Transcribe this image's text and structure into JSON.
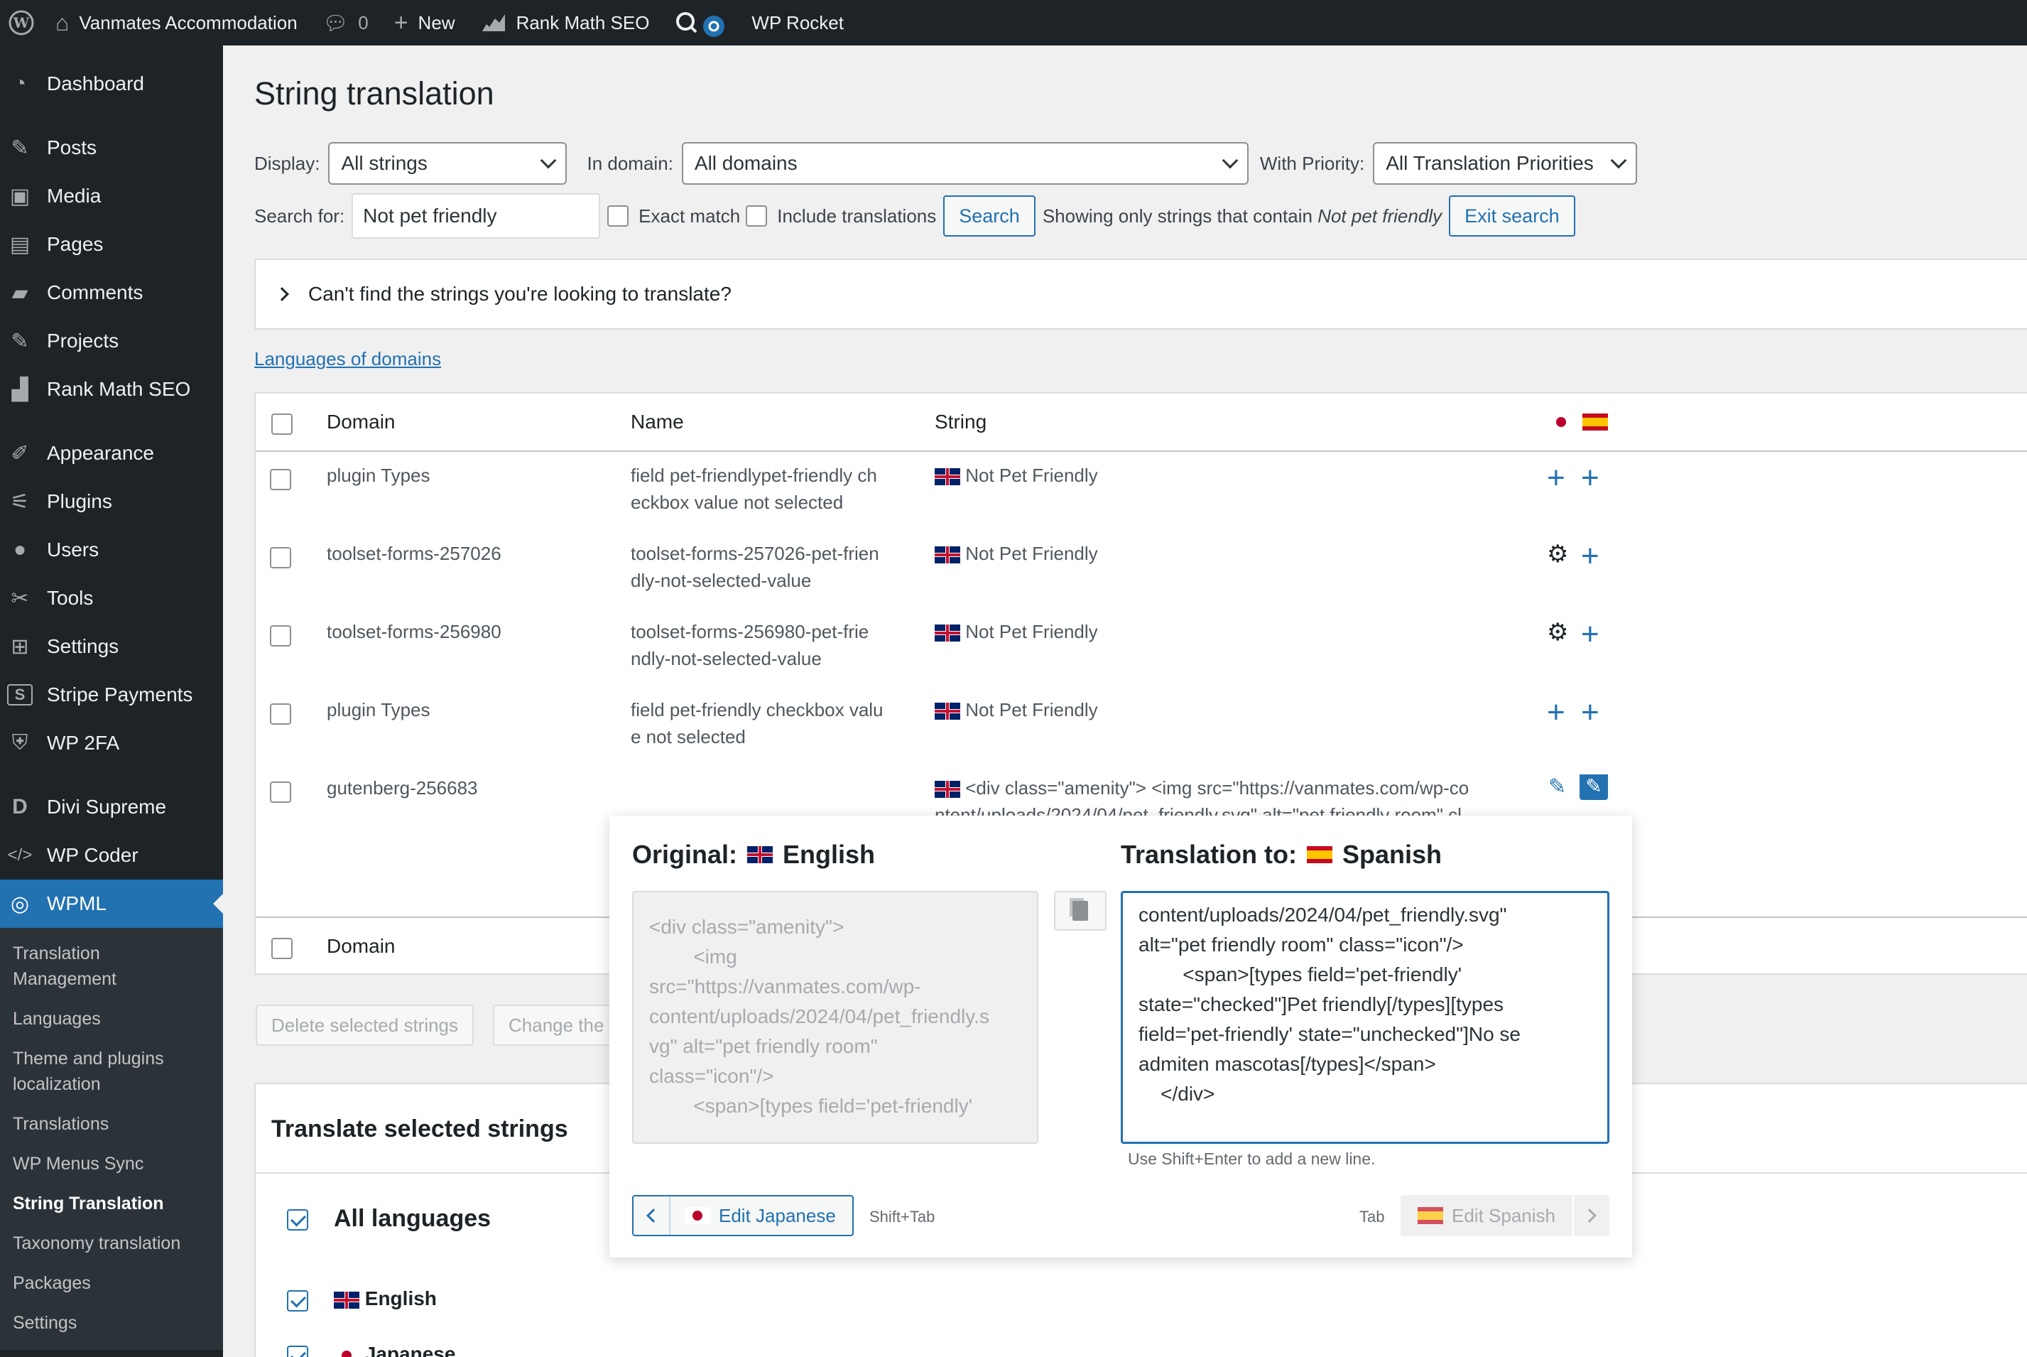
{
  "adminbar": {
    "site_name": "Vanmates Accommodation",
    "comments_count": "0",
    "new_label": "New",
    "rankmath_label": "Rank Math SEO",
    "wprocket_label": "WP Rocket"
  },
  "sidebar": {
    "items": [
      {
        "label": "Dashboard"
      },
      {
        "label": "Posts"
      },
      {
        "label": "Media"
      },
      {
        "label": "Pages"
      },
      {
        "label": "Comments"
      },
      {
        "label": "Projects"
      },
      {
        "label": "Rank Math SEO"
      },
      {
        "label": "Appearance"
      },
      {
        "label": "Plugins"
      },
      {
        "label": "Users"
      },
      {
        "label": "Tools"
      },
      {
        "label": "Settings"
      },
      {
        "label": "Stripe Payments"
      },
      {
        "label": "WP 2FA"
      },
      {
        "label": "Divi Supreme"
      },
      {
        "label": "WP Coder"
      },
      {
        "label": "WPML"
      }
    ],
    "submenu": [
      {
        "label": "Translation Management"
      },
      {
        "label": "Languages"
      },
      {
        "label": "Theme and plugins localization"
      },
      {
        "label": "Translations"
      },
      {
        "label": "WP Menus Sync"
      },
      {
        "label": "String Translation"
      },
      {
        "label": "Taxonomy translation"
      },
      {
        "label": "Packages"
      },
      {
        "label": "Settings"
      }
    ]
  },
  "page": {
    "title": "String translation",
    "display_label": "Display:",
    "display_value": "All strings",
    "domain_label": "In domain:",
    "domain_value": "All domains",
    "priority_label": "With Priority:",
    "priority_value": "All Translation Priorities",
    "search_label": "Search for:",
    "search_value": "Not pet friendly",
    "exact_match": "Exact match",
    "include_translations": "Include translations",
    "search_button": "Search",
    "showing_prefix": "Showing only strings that contain",
    "showing_term": "Not pet friendly",
    "exit_search": "Exit search",
    "cant_find": "Can't find the strings you're looking to translate?",
    "languages_of_domains": "Languages of domains"
  },
  "table": {
    "headers": {
      "domain": "Domain",
      "name": "Name",
      "string": "String"
    },
    "rows": [
      {
        "domain": "plugin Types",
        "name1": "field pet-friendlypet-friendly ch",
        "name2": "eckbox value not selected",
        "string": "Not Pet Friendly"
      },
      {
        "domain": "toolset-forms-257026",
        "name1": "toolset-forms-257026-pet-frien",
        "name2": "dly-not-selected-value",
        "string": "Not Pet Friendly"
      },
      {
        "domain": "toolset-forms-256980",
        "name1": "toolset-forms-256980-pet-frie",
        "name2": "ndly-not-selected-value",
        "string": "Not Pet Friendly"
      },
      {
        "domain": "plugin Types",
        "name1": "field pet-friendly checkbox valu",
        "name2": "e not selected",
        "string": "Not Pet Friendly"
      },
      {
        "domain": "gutenberg-256683",
        "name1": "",
        "name2": "",
        "string": "<div class=\"amenity\"> <img src=\"https://vanmates.com/wp-co",
        "string2": "ntent/uploads/2024/04/pet_friendly.svg\" alt=\"pet friendly room\" cl"
      }
    ],
    "footer_domain": "Domain"
  },
  "bulk": {
    "delete_selected": "Delete selected strings",
    "change_the": "Change the"
  },
  "translate_selected": {
    "title": "Translate selected strings",
    "all_languages": "All languages",
    "english": "English",
    "japanese": "Japanese"
  },
  "popup": {
    "original_label": "Original:",
    "original_lang": "English",
    "translation_label": "Translation to:",
    "translation_lang": "Spanish",
    "original_text": "<div class=\"amenity\">\n        <img\nsrc=\"https://vanmates.com/wp-\ncontent/uploads/2024/04/pet_friendly.s\nvg\" alt=\"pet friendly room\"\nclass=\"icon\"/>\n        <span>[types field='pet-friendly'",
    "translation_text": "content/uploads/2024/04/pet_friendly.svg\"\nalt=\"pet friendly room\" class=\"icon\"/>\n        <span>[types field='pet-friendly'\nstate=\"checked\"]Pet friendly[/types][types\nfield='pet-friendly' state=\"unchecked\"]No se\nadmiten mascotas[/types]</span>\n    </div>",
    "hint": "Use Shift+Enter to add a new line.",
    "prev_label": "Edit Japanese",
    "prev_shortcut": "Shift+Tab",
    "next_shortcut": "Tab",
    "next_label": "Edit Spanish"
  },
  "colors": {
    "admin_dark": "#1d2327",
    "accent": "#2271b1",
    "bg": "#f0f0f1"
  }
}
